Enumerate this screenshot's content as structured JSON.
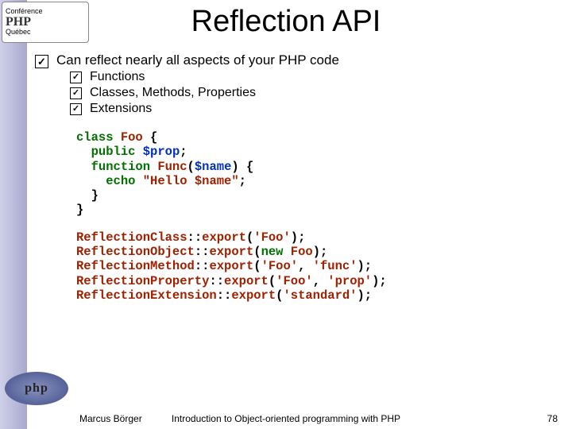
{
  "logo_top": {
    "line1": "Conférence",
    "brand": "PHP",
    "line2": "Québec"
  },
  "logo_bottom": "php",
  "title": "Reflection API",
  "main_bullet": "Can reflect nearly all aspects of your PHP code",
  "sub_bullets": [
    "Functions",
    "Classes, Methods, Properties",
    "Extensions"
  ],
  "code_block1": [
    {
      "t": "kw",
      "v": "class "
    },
    {
      "t": "fn",
      "v": "Foo "
    },
    {
      "t": "pl",
      "v": "{\n"
    },
    {
      "t": "pl",
      "v": "  "
    },
    {
      "t": "kw",
      "v": "public "
    },
    {
      "t": "var",
      "v": "$prop"
    },
    {
      "t": "pl",
      "v": ";\n"
    },
    {
      "t": "pl",
      "v": "  "
    },
    {
      "t": "kw",
      "v": "function "
    },
    {
      "t": "fn",
      "v": "Func"
    },
    {
      "t": "pl",
      "v": "("
    },
    {
      "t": "var",
      "v": "$name"
    },
    {
      "t": "pl",
      "v": ") {\n"
    },
    {
      "t": "pl",
      "v": "    "
    },
    {
      "t": "kw",
      "v": "echo "
    },
    {
      "t": "str",
      "v": "\"Hello $name\""
    },
    {
      "t": "pl",
      "v": ";\n"
    },
    {
      "t": "pl",
      "v": "  }\n"
    },
    {
      "t": "pl",
      "v": "}\n"
    }
  ],
  "code_block2": [
    {
      "t": "fn",
      "v": "ReflectionClass"
    },
    {
      "t": "pl",
      "v": "::"
    },
    {
      "t": "fn",
      "v": "export"
    },
    {
      "t": "pl",
      "v": "("
    },
    {
      "t": "str",
      "v": "'Foo'"
    },
    {
      "t": "pl",
      "v": ");\n"
    },
    {
      "t": "fn",
      "v": "ReflectionObject"
    },
    {
      "t": "pl",
      "v": "::"
    },
    {
      "t": "fn",
      "v": "export"
    },
    {
      "t": "pl",
      "v": "("
    },
    {
      "t": "kw",
      "v": "new "
    },
    {
      "t": "fn",
      "v": "Foo"
    },
    {
      "t": "pl",
      "v": ");\n"
    },
    {
      "t": "fn",
      "v": "ReflectionMethod"
    },
    {
      "t": "pl",
      "v": "::"
    },
    {
      "t": "fn",
      "v": "export"
    },
    {
      "t": "pl",
      "v": "("
    },
    {
      "t": "str",
      "v": "'Foo'"
    },
    {
      "t": "pl",
      "v": ", "
    },
    {
      "t": "str",
      "v": "'func'"
    },
    {
      "t": "pl",
      "v": ");\n"
    },
    {
      "t": "fn",
      "v": "ReflectionProperty"
    },
    {
      "t": "pl",
      "v": "::"
    },
    {
      "t": "fn",
      "v": "export"
    },
    {
      "t": "pl",
      "v": "("
    },
    {
      "t": "str",
      "v": "'Foo'"
    },
    {
      "t": "pl",
      "v": ", "
    },
    {
      "t": "str",
      "v": "'prop'"
    },
    {
      "t": "pl",
      "v": ");\n"
    },
    {
      "t": "fn",
      "v": "ReflectionExtension"
    },
    {
      "t": "pl",
      "v": "::"
    },
    {
      "t": "fn",
      "v": "export"
    },
    {
      "t": "pl",
      "v": "("
    },
    {
      "t": "str",
      "v": "'standard'"
    },
    {
      "t": "pl",
      "v": ");\n"
    }
  ],
  "footer": {
    "author": "Marcus Börger",
    "title": "Introduction to Object-oriented programming with PHP",
    "page": "78"
  }
}
